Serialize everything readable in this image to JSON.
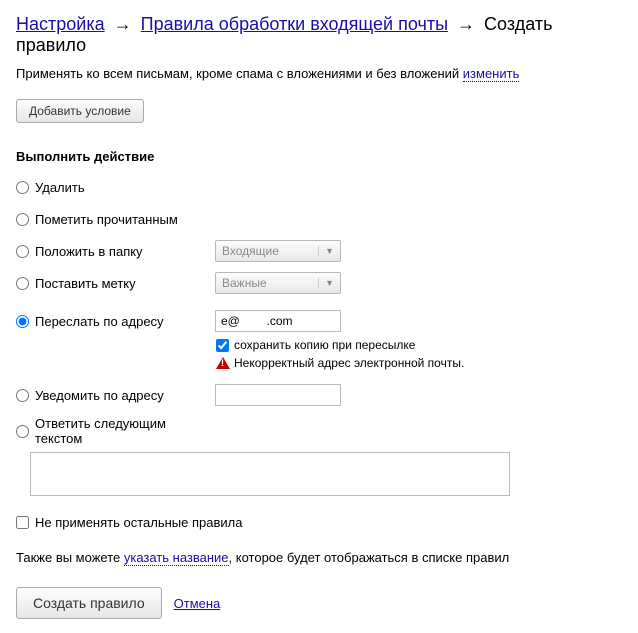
{
  "breadcrumb": {
    "settings": "Настройка",
    "rules": "Правила обработки входящей почты",
    "create": "Создать правило"
  },
  "appliesTo": {
    "text": "Применять ко всем письмам, кроме спама с вложениями и без вложений",
    "editLink": "изменить"
  },
  "addCondition": "Добавить условие",
  "actionTitle": "Выполнить действие",
  "actions": {
    "delete": "Удалить",
    "markRead": "Пометить прочитанным",
    "moveTo": "Положить в папку",
    "moveToFolder": "Входящие",
    "labelAs": "Поставить метку",
    "labelName": "Важные",
    "forwardTo": "Переслать по адресу",
    "forwardAddress": "e@        .com",
    "keepCopy": "сохранить копию при пересылке",
    "invalidEmail": "Некорректный адрес электронной почты.",
    "notifyTo": "Уведомить по адресу",
    "notifyAddress": "",
    "replyWith": "Ответить следующим текстом",
    "replyText": ""
  },
  "stopRules": "Не применять остальные правила",
  "nameHint": {
    "before": "Также вы можете ",
    "link": "указать название",
    "after": ", которое будет отображаться в списке правил"
  },
  "createBtn": "Создать правило",
  "cancel": "Отмена"
}
